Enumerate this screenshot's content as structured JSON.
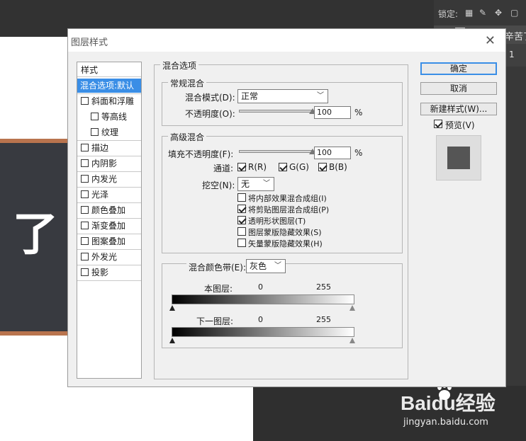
{
  "workspace": {
    "lock_label": "锁定:",
    "layer_name": "辛苦了",
    "layer_num": "1",
    "canvas_char": "了",
    "watermark_logo": "Baidu经验",
    "watermark_url": "jingyan.baidu.com"
  },
  "dialog": {
    "title": "图层样式",
    "close": "✕"
  },
  "style_list": {
    "header": "样式",
    "items": [
      {
        "label": "混合选项:默认",
        "selected": true
      },
      {
        "label": "斜面和浮雕"
      },
      {
        "label": "等高线"
      },
      {
        "label": "纹理"
      },
      {
        "label": "描边"
      },
      {
        "label": "内阴影"
      },
      {
        "label": "内发光"
      },
      {
        "label": "光泽"
      },
      {
        "label": "颜色叠加"
      },
      {
        "label": "渐变叠加"
      },
      {
        "label": "图案叠加"
      },
      {
        "label": "外发光"
      },
      {
        "label": "投影"
      }
    ]
  },
  "blend": {
    "section_title": "混合选项",
    "general": {
      "title": "常规混合",
      "mode_label": "混合模式(D):",
      "mode_value": "正常",
      "opacity_label": "不透明度(O):",
      "opacity_value": "100",
      "opacity_unit": "%",
      "opacity_fraction": 1.0
    },
    "advanced": {
      "title": "高级混合",
      "fill_label": "填充不透明度(F):",
      "fill_value": "100",
      "fill_unit": "%",
      "fill_fraction": 1.0,
      "channels_label": "通道:",
      "channel_r": "R(R)",
      "channel_g": "G(G)",
      "channel_b": "B(B)",
      "knockout_label": "挖空(N):",
      "knockout_value": "无",
      "options": [
        {
          "label": "将内部效果混合成组(I)",
          "checked": false
        },
        {
          "label": "将剪贴图层混合成组(P)",
          "checked": true
        },
        {
          "label": "透明形状图层(T)",
          "checked": true
        },
        {
          "label": "图层蒙版隐藏效果(S)",
          "checked": false
        },
        {
          "label": "矢量蒙版隐藏效果(H)",
          "checked": false
        }
      ]
    },
    "blend_if": {
      "label": "混合颜色带(E):",
      "value": "灰色",
      "this_layer_label": "本图层:",
      "this_low": "0",
      "this_high": "255",
      "under_layer_label": "下一图层:",
      "under_low": "0",
      "under_high": "255"
    }
  },
  "buttons": {
    "ok": "确定",
    "cancel": "取消",
    "new_style": "新建样式(W)...",
    "preview_label": "预览(V)"
  },
  "colors": {
    "accent": "#3a8ee6",
    "preview_swatch": "#555555"
  }
}
